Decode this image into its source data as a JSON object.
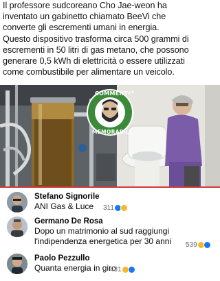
{
  "post": {
    "lines": [
      "Il professore sudcoreano Cho Jae-weon ha",
      "inventato un gabinetto chiamato BeeVi che",
      "converte gli escrementi umani in energia.",
      "Questo dispositivo trasforma circa 500 grammi di",
      "escrementi in 50 litri di gas metano, che possono",
      "generare 0,5 kWh di elettricità o essere utilizzati",
      "come combustibile per alimentare un veicolo."
    ]
  },
  "badge": {
    "top_text": "COMMENTI",
    "bottom_text": "MEMORABILI"
  },
  "comments": [
    {
      "name": "Stefano Signorile",
      "text": [
        "ANI Gas & Luce"
      ],
      "count": "311"
    },
    {
      "name": "Germano De Rosa",
      "text": [
        "Dopo un matrimonio al sud raggiungi",
        "l'indipendenza energetica per 30 anni"
      ],
      "count": "539"
    },
    {
      "name": "Paolo Pezzullo",
      "text": [
        "Quanta energia in giro"
      ],
      "count": "431"
    }
  ],
  "colors": {
    "divider": "#d33a3a",
    "badge_green": "#3a8a3a",
    "like_blue": "#1877f2",
    "haha_yellow": "#f7b928"
  },
  "icons": [
    "like-icon",
    "haha-icon"
  ]
}
